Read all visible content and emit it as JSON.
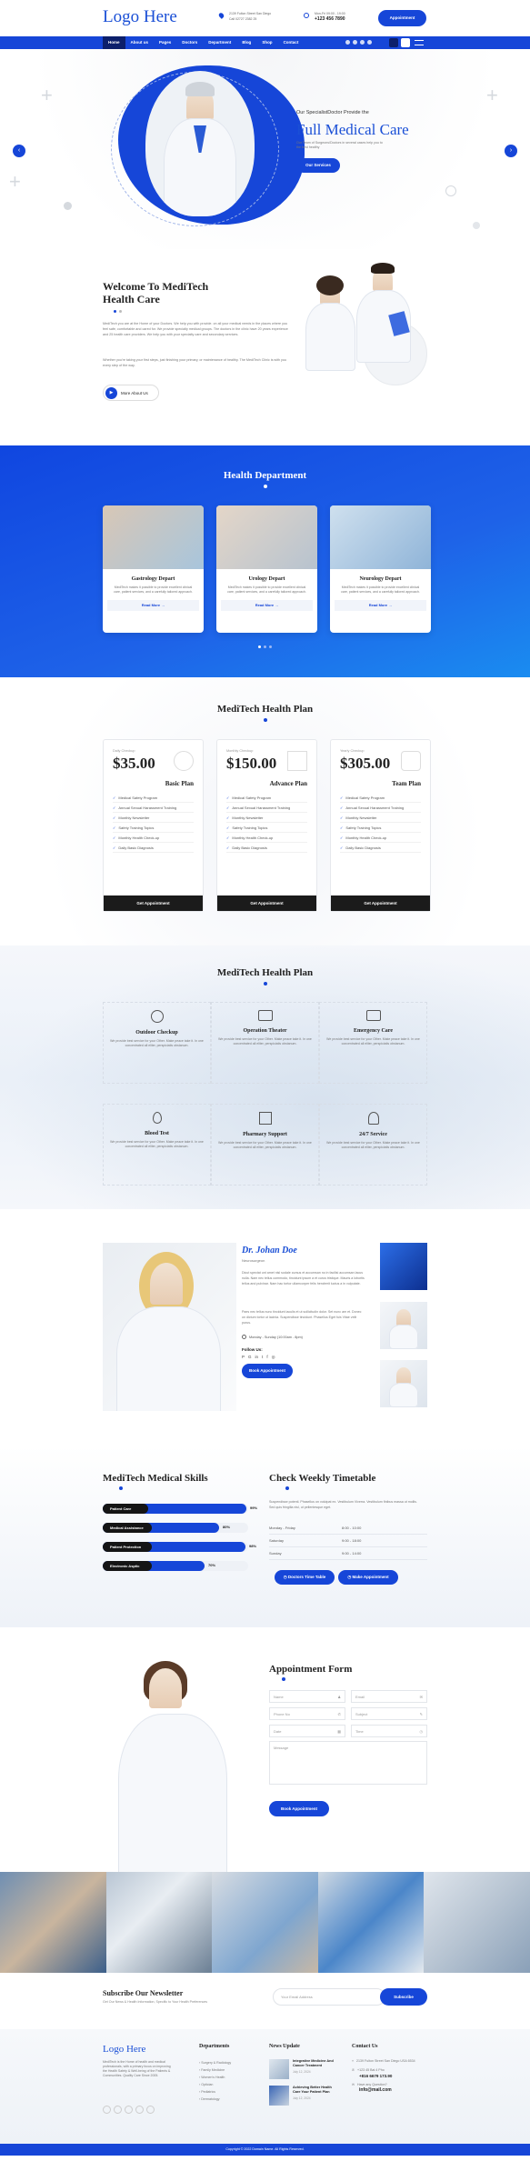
{
  "topbar": {
    "logo": "Logo Here",
    "address": "2139 Fulton Street San Diego",
    "address2": "Call 02727 2382 25",
    "hours": "Mon-Fri 09:00 - 19:00",
    "phone": "+123 456 7890",
    "cta": "Appointment"
  },
  "nav": {
    "items": [
      "Home",
      "About us",
      "Pages",
      "Doctors",
      "Department",
      "Blog",
      "Shop",
      "Contact"
    ]
  },
  "hero": {
    "kicker": "Our SpecialistDoctor Provide the",
    "title": "Full Medical Care",
    "text": "Our Team of Surgeons/Doctors in several cases help you to the best healthy",
    "button": "Our Services"
  },
  "welcome": {
    "title1": "Welcome To MediTech",
    "title2": "Health Care",
    "p1": "MediTech you are at the Home of your Doctors. We help you with provide. on all your medical needs in the places where you feel safe, comfortable and cared for. We provide specialty medical groups. The doctors in the clinic have 20 years experience and 25 health care providers. We help you with your specialty care and secondary services.",
    "p2": "Whether you're taking your first steps, just finishing your primary, or maintenance of healthy. The MediTech Clinic is with you every step of the way.",
    "link": "More About Us"
  },
  "dept": {
    "title": "Health Department",
    "cards": [
      {
        "title": "Gastrology Depart",
        "text": "MediTech makes it possible to provide excellent clinical care, patient services, and a carefully tailored approach.",
        "link": "Read More"
      },
      {
        "title": "Urology Depart",
        "text": "MediTech makes it possible to provide excellent clinical care, patient services, and a carefully tailored approach.",
        "link": "Read More"
      },
      {
        "title": "Neurology Depart",
        "text": "MediTech makes it possible to provide excellent clinical care, patient services, and a carefully tailored approach.",
        "link": "Read More"
      }
    ]
  },
  "plans": {
    "title": "MediTech Health Plan",
    "items": [
      {
        "period": "Daily Checkup",
        "price": "$35.00",
        "name": "Basic Plan",
        "features": [
          "Medical Safety Program",
          "Annual Sexual Harassment Training",
          "Monthly Newsletter",
          "Safety Training Topics",
          "Monthly Health Check-up",
          "Daily Basic Diagnosis"
        ],
        "cta": "Get Appointment"
      },
      {
        "period": "Monthly Checkup",
        "price": "$150.00",
        "name": "Advance Plan",
        "features": [
          "Medical Safety Program",
          "Annual Sexual Harassment Training",
          "Monthly Newsletter",
          "Safety Training Topics",
          "Monthly Health Check-up",
          "Daily Basic Diagnosis"
        ],
        "cta": "Get Appointment"
      },
      {
        "period": "Yearly Checkup",
        "price": "$305.00",
        "name": "Team Plan",
        "features": [
          "Medical Safety Program",
          "Annual Sexual Harassment Training",
          "Monthly Newsletter",
          "Safety Training Topics",
          "Monthly Health Check-up",
          "Daily Basic Diagnosis"
        ],
        "cta": "Get Appointment"
      }
    ]
  },
  "services": {
    "title": "MediTech Health Plan",
    "items": [
      {
        "title": "Outdoor Checkup",
        "text": "We provide best service for your Other. Make peace take it. In one concentrated all eliter, perspiciatis obstanum."
      },
      {
        "title": "Operation Theater",
        "text": "We provide best service for your Other. Make peace take it. In one concentrated all eliter, perspiciatis obstanum."
      },
      {
        "title": "Emergency Care",
        "text": "We provide best service for your Other. Make peace take it. In one concentrated all eliter, perspiciatis obstanum."
      },
      {
        "title": "Blood Test",
        "text": "We provide best service for your Other. Make peace take it. In one concentrated all eliter, perspiciatis obstanum."
      },
      {
        "title": "Pharmacy Support",
        "text": "We provide best service for your Other. Make peace take it. In one concentrated all eliter, perspiciatis obstanum."
      },
      {
        "title": "24/7 Service",
        "text": "We provide best service for your Other. Make peace take it. In one concentrated all eliter, perspiciatis obstanum."
      }
    ]
  },
  "doctor": {
    "name": "Dr. Johan Doe",
    "role": "Neurosurgeon",
    "p1": "Dicut spectat unt amet nisl sodale cursus et accumsan no in facilisi accumsan lacus nulla. Nam nec tellus commodo, tincidunt ipsum a et curus tristique. Mauris a lobortis tellus and pulvinar. Nam hac tortor ullamcorper felis hendrerit luctus a in vulputate.",
    "p2": "Paes nec tellus nunc tincidunt iaculis et ut sollicitudin dolor. Set nunc am et. Donec on dictum tortor ut lacinia. Suspendisse tincidunt. Phasellus Eget fuis Vitae velit purus.",
    "hours": "Monday - Sunday (10:00am - 8pm)",
    "follow": "Follow Us:",
    "button": "Book Appointment"
  },
  "skills": {
    "title": "MediTech Medical Skills",
    "items": [
      {
        "label": "Patient Care",
        "value": "99%",
        "pct": 99
      },
      {
        "label": "Medical Assistance",
        "value": "80%",
        "pct": 80
      },
      {
        "label": "Patient Protection",
        "value": "98%",
        "pct": 98
      },
      {
        "label": "Electronic Asptic",
        "value": "70%",
        "pct": 70
      }
    ]
  },
  "timetable": {
    "title": "Check Weekly Timetable",
    "text": "Suspendisse potenti. Phasellus on volutpat ex. Vestibulum Viverra. Vestibulum finibus massa ut mollis. Sed quis fringilla nisl, ut pellentesque eget.",
    "rows": [
      {
        "day": "Monday - Friday",
        "time": "8:00 - 10:00"
      },
      {
        "day": "Saturday",
        "time": "9:00 - 18:00"
      },
      {
        "day": "Sunday",
        "time": "9:00 - 14:00"
      }
    ],
    "btn1": "Doctors Time Table",
    "btn2": "Make Appointment"
  },
  "appointment": {
    "title": "Appointment Form",
    "fields": [
      "Name",
      "Email",
      "Phone No",
      "Subject",
      "Date",
      "Time",
      "Message"
    ],
    "button": "Book Appointment"
  },
  "newsletter": {
    "title": "Subscribe Our Newsletter",
    "text": "Get Our News & Health Information, Specific to Your Health Preferences",
    "placeholder": "Your Email Address",
    "button": "Subscribe"
  },
  "footer": {
    "logo": "Logo Here",
    "about": "MediTech is the Home of health and medical professionals, with a primary focus on improving the Health Safety & Well-being of the Patients & Communities. Quality Care Since 2005.",
    "dept_title": "Departments",
    "depts": [
      "Surgery & Radiology",
      "Family Medicine",
      "Women's Health",
      "Optician",
      "Pediatrics",
      "Dermatology"
    ],
    "news_title": "News Update",
    "news": [
      {
        "title": "Integrative Medicine And Cancer Treatment",
        "date": "July 12, 2024"
      },
      {
        "title": "Achieving Better Health Care Your Patient Plan",
        "date": "July 12, 2024"
      }
    ],
    "contact_title": "Contact Us",
    "contact": [
      "2139 Fulton Street San Diego USA 6534",
      "+123 45 Bal 4 Pho",
      "Have any Question?"
    ],
    "email": "info@mail.com",
    "phone_line": "+816 6679 173.90",
    "copyright": "Copyright © 2022 Domain Name. All Rights Reserved."
  }
}
